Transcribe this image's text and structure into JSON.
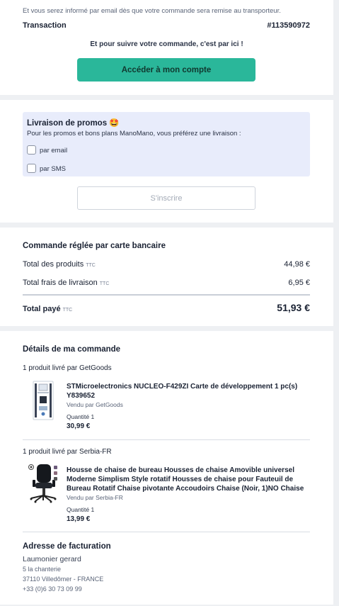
{
  "top": {
    "info_text": "Et vous serez informé par email dès que votre commande sera remise au transporteur.",
    "transaction_label": "Transaction",
    "transaction_value": "#113590972",
    "follow_text": "Et pour suivre votre commande, c'est par ici !",
    "account_button": "Accéder à mon compte"
  },
  "promo": {
    "title": "Livraison de promos 🤩",
    "subtitle": "Pour les promos et bons plans ManoMano, vous préférez une livraison :",
    "option_email": "par email",
    "option_sms": "par SMS",
    "subscribe_button": "S'inscrire"
  },
  "payment": {
    "title": "Commande réglée par carte bancaire",
    "products_label": "Total des produits",
    "products_ttc": "TTC",
    "products_value": "44,98 €",
    "shipping_label": "Total frais de livraison",
    "shipping_ttc": "TTC",
    "shipping_value": "6,95 €",
    "total_label": "Total payé",
    "total_ttc": "TTC",
    "total_value": "51,93 €"
  },
  "details": {
    "title": "Détails de ma commande",
    "groups": [
      {
        "seller_heading": "1 produit livré par GetGoods",
        "product_title": "STMicroelectronics NUCLEO-F429ZI Carte de développement 1 pc(s) Y839652",
        "sold_by": "Vendu par GetGoods",
        "quantity": "Quantité 1",
        "price": "30,99 €"
      },
      {
        "seller_heading": "1 produit livré par Serbia-FR",
        "product_title": "Housse de chaise de bureau Housses de chaise Amovible universel Moderne Simplism Style rotatif Housses de chaise pour Fauteuil de Bureau Rotatif Chaise pivotante Accoudoirs Chaise (Noir, 1)NO Chaise",
        "sold_by": "Vendu par Serbia-FR",
        "quantity": "Quantité 1",
        "price": "13,99 €"
      }
    ],
    "billing": {
      "title": "Adresse de facturation",
      "name": "Laumonier gerard",
      "street": "5 la chanterie",
      "city": "37110 Villedômer - FRANCE",
      "phone": "+33 (0)6 30 73 09 99"
    }
  },
  "colors": {
    "accent": "#2ab79a",
    "promo_bg": "#e8ecfb",
    "page_bg": "#eef0f3"
  },
  "icons": {
    "product_1": "circuit-board-image",
    "product_2": "office-chair-image"
  }
}
